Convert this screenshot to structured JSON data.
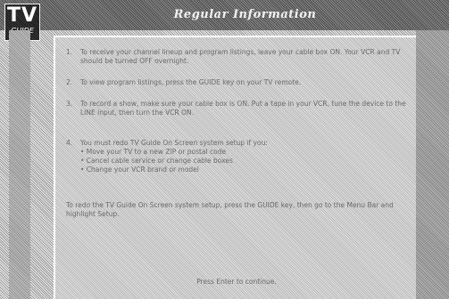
{
  "header": {
    "logo_main": "TV",
    "logo_sub": "GUIDE",
    "title": "Regular Information"
  },
  "steps": [
    {
      "number": "1.",
      "text": "To receive your channel lineup and program listings, leave your cable box ON. Your VCR and TV should be turned OFF overnight."
    },
    {
      "number": "2.",
      "text": "To view program listings, press the GUIDE key on your TV remote."
    },
    {
      "number": "3.",
      "text": "To record a show, make sure your cable box is ON. Put a tape in your VCR, tune the device to the LINE input, then turn the VCR ON."
    },
    {
      "number": "4.",
      "text": "You must redo TV Guide On Screen system setup if you:",
      "bullets": [
        "• Move your TV to a new ZIP or postal code",
        "• Cancel cable service or change cable boxes",
        "• Change your VCR brand or model"
      ]
    }
  ],
  "outro": "To redo the TV Guide On Screen system setup, press the GUIDE key, then go to the Menu Bar and highlight Setup.",
  "prompt": "Press Enter to continue."
}
